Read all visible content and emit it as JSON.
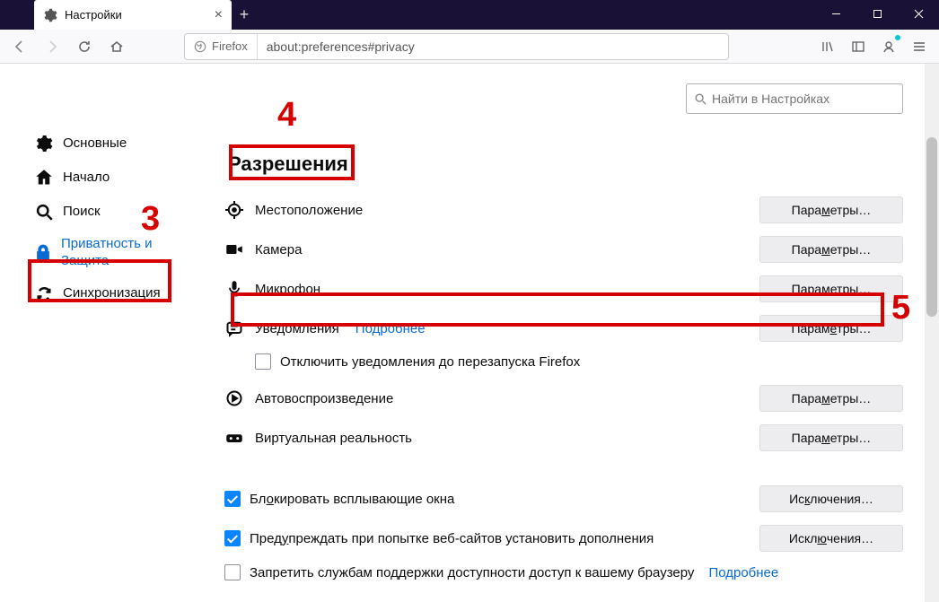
{
  "window": {
    "tab_title": "Настройки"
  },
  "urlbar": {
    "identity": "Firefox",
    "url": "about:preferences#privacy"
  },
  "search": {
    "placeholder": "Найти в Настройках"
  },
  "sidebar": {
    "items": [
      {
        "label": "Основные"
      },
      {
        "label": "Начало"
      },
      {
        "label": "Поиск"
      },
      {
        "label": "Приватность и Защита"
      },
      {
        "label": "Синхронизация"
      }
    ]
  },
  "section": {
    "title": "Разрешения"
  },
  "permissions": {
    "location": "Местоположение",
    "camera": "Камера",
    "microphone": "Микрофон",
    "notifications": "Уведомления",
    "notifications_more": "Подробнее",
    "notifications_pause": "Отключить уведомления до перезапуска Firefox",
    "autoplay": "Автовоспроизведение",
    "vr": "Виртуальная реальность"
  },
  "buttons": {
    "settings_pre": "Пара",
    "settings_m": "м",
    "settings_post": "етры…",
    "settings_pre2": "Параметр",
    "settings_y": "ы",
    "settings_post2": "…",
    "settings_pre3": "Парам",
    "settings_e": "е",
    "settings_post3": "тры…",
    "exceptions_pre": "Ис",
    "exceptions_k": "к",
    "exceptions_post": "лючения…",
    "exceptions2_pre": "Искл",
    "exceptions2_yu": "ю",
    "exceptions2_post": "чения…"
  },
  "checkboxes": {
    "popup_pre": "Бл",
    "popup_o": "о",
    "popup_post": "кировать всплывающие окна",
    "addons_pre": "Пред",
    "addons_u": "у",
    "addons_post": "преждать при попытке веб-сайтов установить дополнения",
    "a11y": "Запретить службам поддержки доступности доступ к вашему браузеру",
    "a11y_more": "Подробнее"
  },
  "annotations": {
    "n3": "3",
    "n4": "4",
    "n5": "5"
  }
}
